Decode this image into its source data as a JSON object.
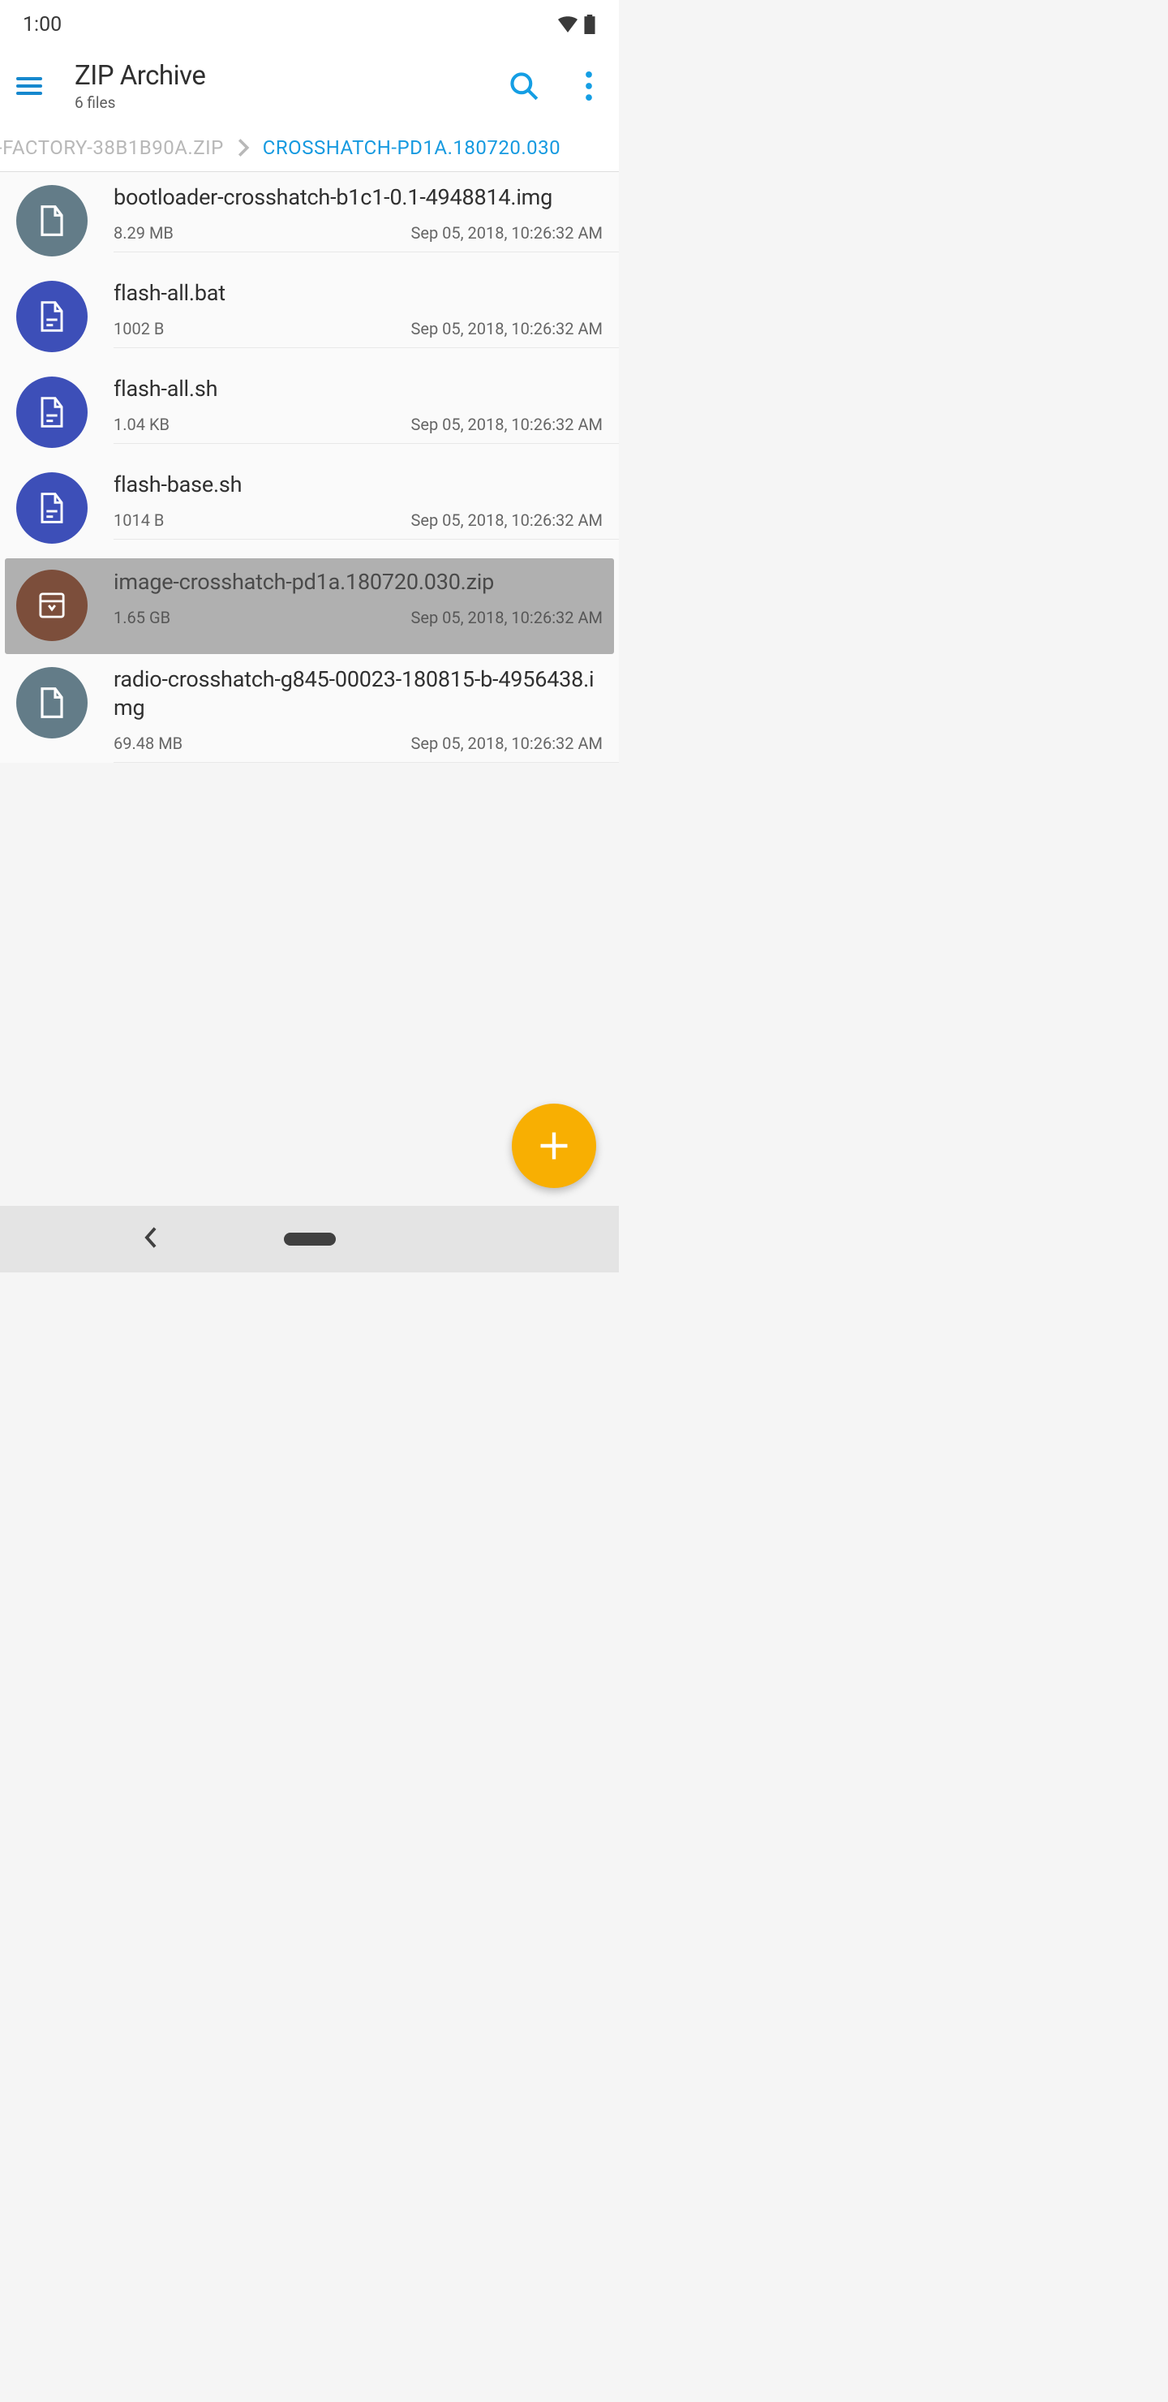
{
  "status": {
    "time": "1:00"
  },
  "appbar": {
    "title": "ZIP Archive",
    "subtitle": "6 files"
  },
  "breadcrumb": {
    "prev": "-FACTORY-38B1B90A.ZIP",
    "current": "CROSSHATCH-PD1A.180720.030"
  },
  "files": [
    {
      "name": "bootloader-crosshatch-b1c1-0.1-4948814.img",
      "size": "8.29 MB",
      "date": "Sep 05, 2018, 10:26:32 AM",
      "type": "img",
      "selected": false
    },
    {
      "name": "flash-all.bat",
      "size": "1002 B",
      "date": "Sep 05, 2018, 10:26:32 AM",
      "type": "doc",
      "selected": false
    },
    {
      "name": "flash-all.sh",
      "size": "1.04 KB",
      "date": "Sep 05, 2018, 10:26:32 AM",
      "type": "doc",
      "selected": false
    },
    {
      "name": "flash-base.sh",
      "size": "1014 B",
      "date": "Sep 05, 2018, 10:26:32 AM",
      "type": "doc",
      "selected": false
    },
    {
      "name": "image-crosshatch-pd1a.180720.030.zip",
      "size": "1.65 GB",
      "date": "Sep 05, 2018, 10:26:32 AM",
      "type": "zip",
      "selected": true
    },
    {
      "name": "radio-crosshatch-g845-00023-180815-b-4956438.img",
      "size": "69.48 MB",
      "date": "Sep 05, 2018, 10:26:32 AM",
      "type": "img",
      "selected": false
    }
  ]
}
